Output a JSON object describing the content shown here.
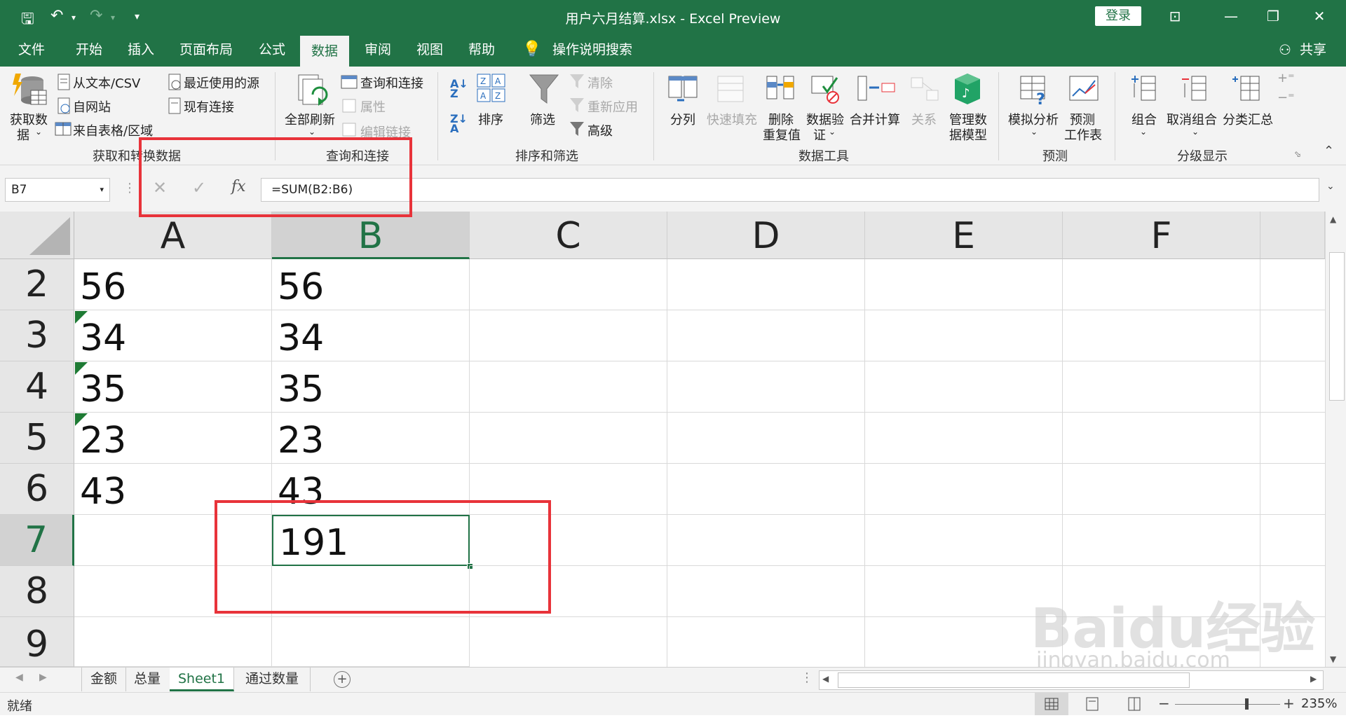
{
  "title_bar": {
    "title": "用户六月结算.xlsx  -  Excel Preview",
    "login_label": "登录"
  },
  "tabs": [
    "文件",
    "开始",
    "插入",
    "页面布局",
    "公式",
    "数据",
    "审阅",
    "视图",
    "帮助"
  ],
  "active_tab": "数据",
  "tell_me": "操作说明搜索",
  "share": "共享",
  "ribbon": {
    "get_data": {
      "label1": "获取数",
      "label2": "据",
      "from_text": "从文本/CSV",
      "from_web": "自网站",
      "from_table": "来自表格/区域",
      "recent": "最近使用的源",
      "existing": "现有连接",
      "group": "获取和转换数据"
    },
    "queries": {
      "refresh_all": "全部刷新",
      "queries_conn": "查询和连接",
      "properties": "属性",
      "edit_links": "编辑链接",
      "group": "查询和连接"
    },
    "sort_filter": {
      "sort": "排序",
      "filter": "筛选",
      "clear": "清除",
      "reapply": "重新应用",
      "advanced": "高级",
      "group": "排序和筛选"
    },
    "data_tools": {
      "text_to_columns": "分列",
      "flash_fill": "快速填充",
      "remove_dup1": "删除",
      "remove_dup2": "重复值",
      "validation1": "数据验",
      "validation2": "证",
      "consolidate": "合并计算",
      "relations": "关系",
      "manage1": "管理数",
      "manage2": "据模型",
      "group": "数据工具"
    },
    "forecast": {
      "whatif": "模拟分析",
      "sheet1": "预测",
      "sheet2": "工作表",
      "group": "预测"
    },
    "outline": {
      "group_btn": "组合",
      "ungroup": "取消组合",
      "subtotal": "分类汇总",
      "group": "分级显示"
    }
  },
  "formula_bar": {
    "name_box": "B7",
    "fx": "fx",
    "formula": "=SUM(B2:B6)"
  },
  "columns": [
    "A",
    "B",
    "C",
    "D",
    "E",
    "F"
  ],
  "rows": [
    {
      "num": "2",
      "a": "56",
      "b": "56"
    },
    {
      "num": "3",
      "a": "34",
      "b": "34"
    },
    {
      "num": "4",
      "a": "35",
      "b": "35"
    },
    {
      "num": "5",
      "a": "23",
      "b": "23"
    },
    {
      "num": "6",
      "a": "43",
      "b": "43"
    },
    {
      "num": "7",
      "a": "",
      "b": "191"
    },
    {
      "num": "8",
      "a": "",
      "b": ""
    },
    {
      "num": "9",
      "a": "",
      "b": ""
    }
  ],
  "sheets": [
    "金额",
    "总量",
    "Sheet1",
    "通过数量"
  ],
  "active_sheet": "Sheet1",
  "status": {
    "ready": "就绪",
    "zoom": "235%"
  },
  "watermark": {
    "brand": "Bai",
    "brand2": "du",
    "brand3": "经验",
    "url": "jingyan.baidu.com"
  },
  "colors": {
    "excel_green": "#217346",
    "highlight_red": "#e8333a"
  }
}
